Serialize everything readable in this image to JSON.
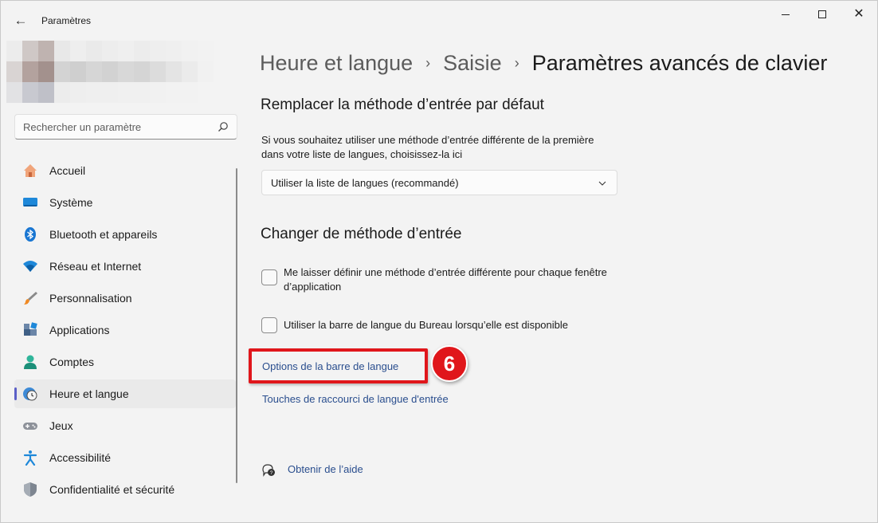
{
  "window": {
    "title": "Paramètres",
    "back_label": "←",
    "controls": {
      "minimize": "minimize-icon",
      "maximize": "maximize-icon",
      "close": "✕"
    }
  },
  "sidebar": {
    "search": {
      "placeholder": "Rechercher un paramètre",
      "value": ""
    },
    "items": [
      {
        "label": "Accueil",
        "icon": "home-icon"
      },
      {
        "label": "Système",
        "icon": "monitor-icon"
      },
      {
        "label": "Bluetooth et appareils",
        "icon": "bluetooth-icon"
      },
      {
        "label": "Réseau et Internet",
        "icon": "wifi-icon"
      },
      {
        "label": "Personnalisation",
        "icon": "paintbrush-icon"
      },
      {
        "label": "Applications",
        "icon": "apps-icon"
      },
      {
        "label": "Comptes",
        "icon": "person-icon"
      },
      {
        "label": "Heure et langue",
        "icon": "clock-globe-icon",
        "active": true
      },
      {
        "label": "Jeux",
        "icon": "gamepad-icon"
      },
      {
        "label": "Accessibilité",
        "icon": "accessibility-icon"
      },
      {
        "label": "Confidentialité et sécurité",
        "icon": "shield-icon"
      }
    ]
  },
  "breadcrumb": {
    "items": [
      "Heure et langue",
      "Saisie",
      "Paramètres avancés de clavier"
    ],
    "separator": "›"
  },
  "main": {
    "section1": {
      "title": "Remplacer la méthode d’entrée par défaut",
      "description": "Si vous souhaitez utiliser une méthode d’entrée différente de la première dans votre liste de langues, choisissez-la ici",
      "dropdown_value": "Utiliser la liste de langues (recommandé)"
    },
    "section2": {
      "title": "Changer de méthode d’entrée",
      "checkbox1": {
        "label": "Me laisser définir une méthode d’entrée différente pour chaque fenêtre d’application",
        "checked": false
      },
      "checkbox2": {
        "label": "Utiliser la barre de langue du Bureau lorsqu’elle est disponible",
        "checked": false
      }
    },
    "links": {
      "language_bar_options": "Options de la barre de langue",
      "hotkeys": "Touches de raccourci de langue d'entrée"
    },
    "help": {
      "label": "Obtenir de l’aide",
      "icon": "help-icon"
    }
  },
  "annotation": {
    "step_number": "6",
    "color": "#e0161b"
  },
  "colors": {
    "accent": "#5b5fc7",
    "link": "#2a4e8e",
    "background": "#f3f3f3"
  }
}
